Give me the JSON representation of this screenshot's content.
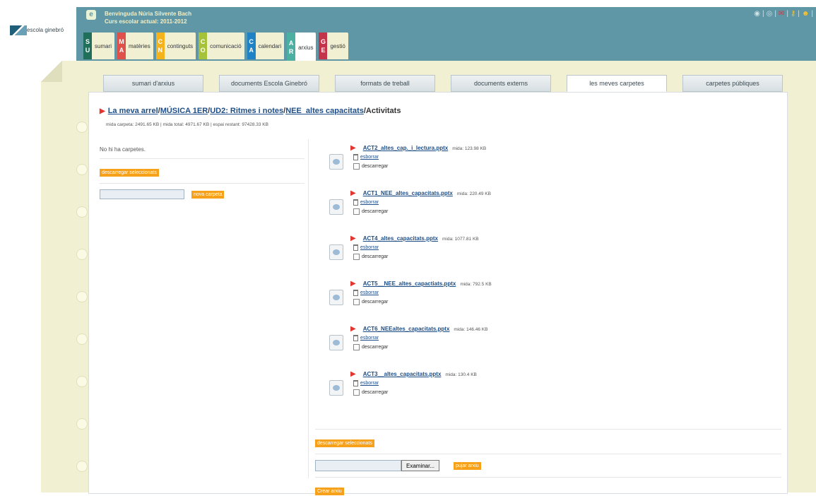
{
  "brand": {
    "logo_text": "escola ginebró"
  },
  "header": {
    "welcome": "Benvinguda Núria Silvente Bach",
    "school_year": "Curs escolar actual: 2011-2012",
    "main_tabs": [
      {
        "code": [
          "S",
          "U"
        ],
        "label": "sumari",
        "color": "#1f6f5a"
      },
      {
        "code": [
          "M",
          "A"
        ],
        "label": "matèries",
        "color": "#e0504b"
      },
      {
        "code": [
          "C",
          "N"
        ],
        "label": "continguts",
        "color": "#f4b31d"
      },
      {
        "code": [
          "C",
          "O"
        ],
        "label": "comunicació",
        "color": "#a6c13a"
      },
      {
        "code": [
          "C",
          "A"
        ],
        "label": "calendari",
        "color": "#1f82c4"
      },
      {
        "code": [
          "A",
          "R"
        ],
        "label": "arxius",
        "color": "#4bb0a2"
      },
      {
        "code": [
          "G",
          "E"
        ],
        "label": "gestió",
        "color": "#c3344b"
      }
    ],
    "top_icons": [
      "globe-icon",
      "info-icon",
      "mail-icon",
      "key-icon",
      "user-icon"
    ]
  },
  "sub_tabs": [
    "sumari d'arxius",
    "documents Escola Ginebró",
    "formats de treball",
    "documents externs",
    "les meves carpetes",
    "carpetes públiques"
  ],
  "breadcrumb": {
    "links": [
      "La meva arrel",
      "MÚSICA 1ER",
      "UD2: Ritmes i notes",
      "NEE_altes capacitats"
    ],
    "current": "Activitats"
  },
  "sizes_line": "mida carpeta: 2491.65 KB | mida total: 4971.67 KB | espai restant: 97428.33 KB",
  "left_panel": {
    "no_folders": "No hi ha carpetes.",
    "download_selected": "descarregar seleccionats",
    "new_folder": "nova carpeta"
  },
  "files": [
    {
      "name": "ACT2_altes_cap._i_lectura.pptx",
      "size": "mida: 123.98 KB",
      "delete": "esborrar",
      "download": "descarregar"
    },
    {
      "name": "ACT1_NEE_altes_capacitats.pptx",
      "size": "mida: 220.49 KB",
      "delete": "esborrar",
      "download": "descarregar"
    },
    {
      "name": "ACT4_altes_capacitats.pptx",
      "size": "mida: 1077.81 KB",
      "delete": "esborrar",
      "download": "descarregar"
    },
    {
      "name": "ACT5__NEE_altes_capactiats.pptx",
      "size": "mida: 792.5 KB",
      "delete": "esborrar",
      "download": "descarregar"
    },
    {
      "name": "ACT6_NEEaltes_capacitats.pptx",
      "size": "mida: 146.46 KB",
      "delete": "esborrar",
      "download": "descarregar"
    },
    {
      "name": "ACT3__altes_capacitats.pptx",
      "size": "mida: 130.4 KB",
      "delete": "esborrar",
      "download": "descarregar"
    }
  ],
  "right_bottom": {
    "download_selected": "descarregar seleccionats",
    "browse": "Examinar...",
    "upload": "pujar arxiu",
    "create": "Crear arxiu"
  }
}
